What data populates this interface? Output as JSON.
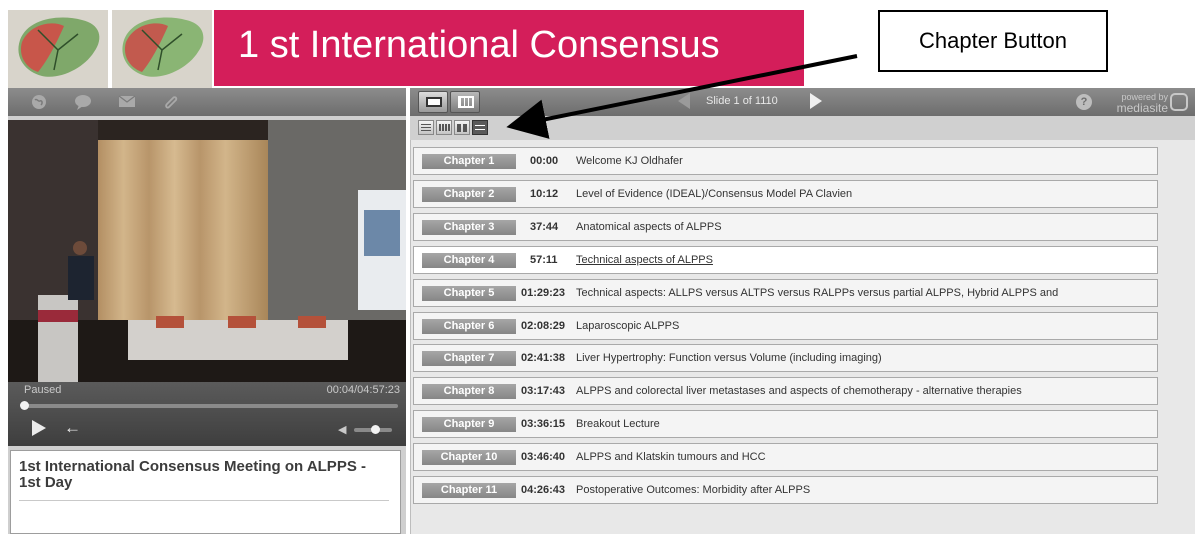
{
  "banner": {
    "title": "1 st International Consensus"
  },
  "annotation": {
    "label": "Chapter Button"
  },
  "left_toolbar": {
    "icons": [
      "globe-icon",
      "comment-icon",
      "mail-icon",
      "attachment-icon"
    ]
  },
  "slide_nav": {
    "counter": "Slide 1 of 1110"
  },
  "branding": {
    "powered_by_line1": "powered by",
    "powered_by_line2": "mediasite"
  },
  "player": {
    "status": "Paused",
    "time": "00:04/04:57:23",
    "progress": 0.013,
    "volume": 0.55
  },
  "presentation": {
    "title": "1st International Consensus Meeting on ALPPS - 1st Day"
  },
  "chapters": [
    {
      "label": "Chapter 1",
      "time": "00:00",
      "title": "Welcome KJ Oldhafer"
    },
    {
      "label": "Chapter 2",
      "time": "10:12",
      "title": "Level of Evidence (IDEAL)/Consensus Model PA Clavien"
    },
    {
      "label": "Chapter 3",
      "time": "37:44",
      "title": "Anatomical aspects of ALPPS"
    },
    {
      "label": "Chapter 4",
      "time": "57:11",
      "title": "Technical aspects of ALPPS"
    },
    {
      "label": "Chapter 5",
      "time": "01:29:23",
      "title": "Technical aspects: ALLPS versus ALTPS versus RALPPs versus partial ALPPS, Hybrid ALPPS and"
    },
    {
      "label": "Chapter 6",
      "time": "02:08:29",
      "title": "Laparoscopic ALPPS"
    },
    {
      "label": "Chapter 7",
      "time": "02:41:38",
      "title": "Liver Hypertrophy: Function versus Volume (including imaging)"
    },
    {
      "label": "Chapter 8",
      "time": "03:17:43",
      "title": "ALPPS and colorectal liver metastases and aspects of chemotherapy - alternative therapies"
    },
    {
      "label": "Chapter 9",
      "time": "03:36:15",
      "title": "Breakout Lecture"
    },
    {
      "label": "Chapter 10",
      "time": "03:46:40",
      "title": "ALPPS and Klatskin tumours and HCC"
    },
    {
      "label": "Chapter 11",
      "time": "04:26:43",
      "title": "Postoperative Outcomes: Morbidity after ALPPS"
    }
  ],
  "current_chapter_index": 3,
  "colors": {
    "banner_accent": "#d41e5a",
    "toolbar": "#7a7a7a",
    "chapter_badge": "#969696"
  }
}
